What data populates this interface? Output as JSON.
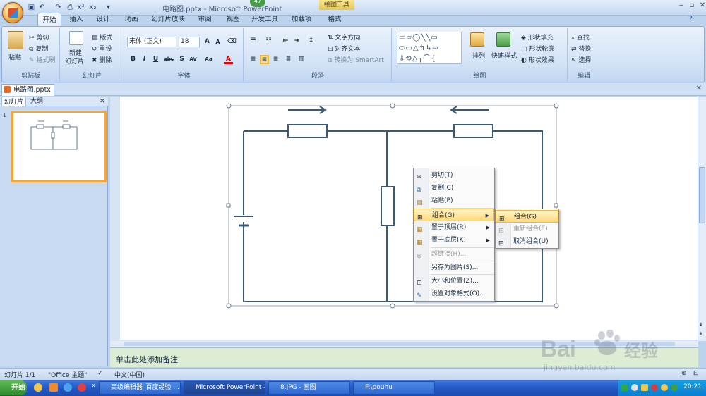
{
  "window": {
    "title": "电路图.pptx - Microsoft PowerPoint",
    "context_tab_group": "绘图工具",
    "notification_count": "47"
  },
  "ribbon_tabs": [
    "开始",
    "插入",
    "设计",
    "动画",
    "幻灯片放映",
    "审阅",
    "视图",
    "开发工具",
    "加载项",
    "格式"
  ],
  "ribbon": {
    "clipboard": {
      "paste": "粘贴",
      "cut": "剪切",
      "copy": "复制",
      "format_painter": "格式刷",
      "group_label": "剪贴板"
    },
    "slides": {
      "new_slide": "新建",
      "new_slide2": "幻灯片",
      "layout": "版式",
      "reset": "重设",
      "delete": "删除",
      "group_label": "幻灯片"
    },
    "font": {
      "font_name": "宋体 (正文)",
      "font_size": "18",
      "group_label": "字体"
    },
    "paragraph": {
      "text_direction": "文字方向",
      "align_text": "对齐文本",
      "smartart": "转换为 SmartArt",
      "group_label": "段落"
    },
    "drawing": {
      "arrange": "排列",
      "quick_styles": "快速样式",
      "shape_fill": "形状填充",
      "shape_outline": "形状轮廓",
      "shape_effects": "形状效果",
      "group_label": "绘图"
    },
    "editing": {
      "find": "查找",
      "replace": "替换",
      "select": "选择",
      "group_label": "编辑"
    }
  },
  "doc_tab": "电路图.pptx",
  "left_pane": {
    "tab_slides": "幻灯片",
    "tab_outline": "大纲",
    "slide_number": "1"
  },
  "notes_placeholder": "单击此处添加备注",
  "status": {
    "slide_info": "幻灯片 1/1",
    "theme": "\"Office 主题\"",
    "language": "中文(中国)"
  },
  "context_menu": [
    {
      "label": "剪切(T)",
      "disabled": false,
      "submenu": false
    },
    {
      "label": "复制(C)",
      "disabled": false,
      "submenu": false
    },
    {
      "label": "粘贴(P)",
      "disabled": false,
      "submenu": false
    },
    {
      "label": "组合(G)",
      "disabled": false,
      "submenu": true,
      "highlighted": true
    },
    {
      "label": "置于顶层(R)",
      "disabled": false,
      "submenu": true
    },
    {
      "label": "置于底层(K)",
      "disabled": false,
      "submenu": true
    },
    {
      "label": "超链接(H)...",
      "disabled": true,
      "submenu": false
    },
    {
      "label": "另存为图片(S)...",
      "disabled": false,
      "submenu": false
    },
    {
      "label": "大小和位置(Z)...",
      "disabled": false,
      "submenu": false
    },
    {
      "label": "设置对象格式(O)...",
      "disabled": false,
      "submenu": false
    }
  ],
  "submenu": [
    {
      "label": "组合(G)",
      "disabled": false,
      "highlighted": true
    },
    {
      "label": "重新组合(E)",
      "disabled": true
    },
    {
      "label": "取消组合(U)",
      "disabled": false
    }
  ],
  "taskbar": {
    "start": "开始",
    "tasks": [
      "高级编辑器_百度经验 ...",
      "Microsoft PowerPoint - [...",
      "8.JPG - 画图",
      "F:\\pouhu"
    ],
    "clock": "20:21"
  },
  "watermark": {
    "brand": "Bai",
    "brand2": "经验",
    "url": "jingyan.baidu.com"
  },
  "colors": {
    "ribbon_bg": "#d2e2f6",
    "highlight": "#ffd97a",
    "circuit": "#3b5a78",
    "notes_bg": "#ddecd5",
    "taskbar": "#2459c6"
  }
}
